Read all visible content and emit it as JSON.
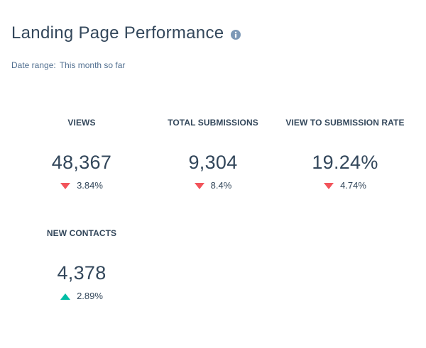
{
  "header": {
    "title": "Landing Page Performance",
    "info_icon": "info-circle-icon",
    "date_range_label": "Date range:",
    "date_range_value": "This month so far"
  },
  "colors": {
    "text": "#33475b",
    "subtext": "#516f90",
    "info_icon": "#7c98b6",
    "decrease": "#f2545b",
    "increase": "#00bda5"
  },
  "metrics": [
    {
      "label": "VIEWS",
      "value": "48,367",
      "change": "3.84%",
      "direction": "down"
    },
    {
      "label": "TOTAL SUBMISSIONS",
      "value": "9,304",
      "change": "8.4%",
      "direction": "down"
    },
    {
      "label": "VIEW TO SUBMISSION RATE",
      "value": "19.24%",
      "change": "4.74%",
      "direction": "down"
    },
    {
      "label": "NEW CONTACTS",
      "value": "4,378",
      "change": "2.89%",
      "direction": "up"
    }
  ]
}
